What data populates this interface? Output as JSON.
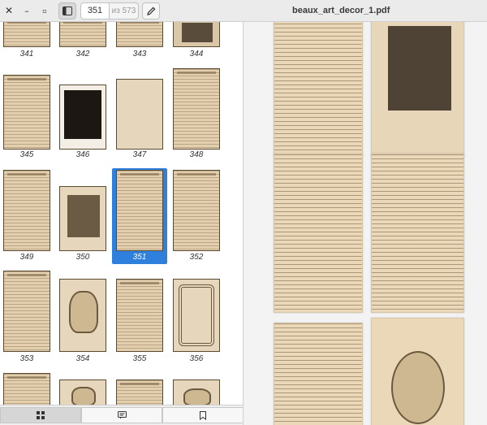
{
  "window": {
    "close_icon": "close-icon",
    "minimize_icon": "minimize-icon",
    "maximize_icon": "maximize-icon"
  },
  "toolbar": {
    "sidebar_toggle_icon": "sidebar-icon",
    "page_number": "351",
    "page_total": "из 573",
    "annotate_icon": "pencil-icon"
  },
  "document": {
    "title": "beaux_art_decor_1.pdf"
  },
  "thumbnails": {
    "labels": [
      "341",
      "342",
      "343",
      "344",
      "345",
      "346",
      "347",
      "348",
      "349",
      "350",
      "351",
      "352",
      "353",
      "354",
      "355",
      "356"
    ],
    "selected": "351"
  },
  "switcher": {
    "thumbnails_icon": "grid-icon",
    "annotations_icon": "comment-icon",
    "bookmarks_icon": "bookmark-icon"
  },
  "colors": {
    "accent": "#2f7fdc",
    "page_paper": "#ead8b8",
    "header_bg": "#ebebeb"
  }
}
